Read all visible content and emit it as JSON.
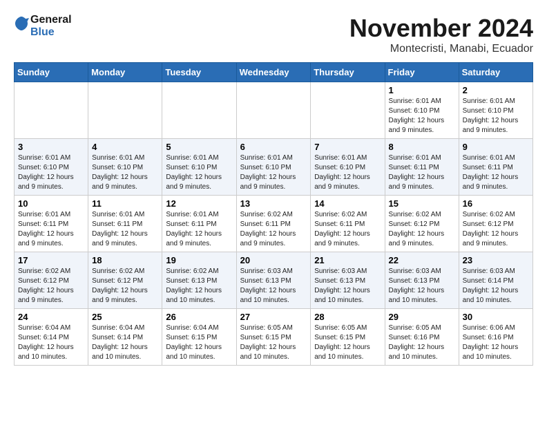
{
  "header": {
    "logo_line1": "General",
    "logo_line2": "Blue",
    "month_title": "November 2024",
    "subtitle": "Montecristi, Manabi, Ecuador"
  },
  "days_of_week": [
    "Sunday",
    "Monday",
    "Tuesday",
    "Wednesday",
    "Thursday",
    "Friday",
    "Saturday"
  ],
  "weeks": [
    [
      {
        "day": "",
        "info": ""
      },
      {
        "day": "",
        "info": ""
      },
      {
        "day": "",
        "info": ""
      },
      {
        "day": "",
        "info": ""
      },
      {
        "day": "",
        "info": ""
      },
      {
        "day": "1",
        "info": "Sunrise: 6:01 AM\nSunset: 6:10 PM\nDaylight: 12 hours and 9 minutes."
      },
      {
        "day": "2",
        "info": "Sunrise: 6:01 AM\nSunset: 6:10 PM\nDaylight: 12 hours and 9 minutes."
      }
    ],
    [
      {
        "day": "3",
        "info": "Sunrise: 6:01 AM\nSunset: 6:10 PM\nDaylight: 12 hours and 9 minutes."
      },
      {
        "day": "4",
        "info": "Sunrise: 6:01 AM\nSunset: 6:10 PM\nDaylight: 12 hours and 9 minutes."
      },
      {
        "day": "5",
        "info": "Sunrise: 6:01 AM\nSunset: 6:10 PM\nDaylight: 12 hours and 9 minutes."
      },
      {
        "day": "6",
        "info": "Sunrise: 6:01 AM\nSunset: 6:10 PM\nDaylight: 12 hours and 9 minutes."
      },
      {
        "day": "7",
        "info": "Sunrise: 6:01 AM\nSunset: 6:10 PM\nDaylight: 12 hours and 9 minutes."
      },
      {
        "day": "8",
        "info": "Sunrise: 6:01 AM\nSunset: 6:11 PM\nDaylight: 12 hours and 9 minutes."
      },
      {
        "day": "9",
        "info": "Sunrise: 6:01 AM\nSunset: 6:11 PM\nDaylight: 12 hours and 9 minutes."
      }
    ],
    [
      {
        "day": "10",
        "info": "Sunrise: 6:01 AM\nSunset: 6:11 PM\nDaylight: 12 hours and 9 minutes."
      },
      {
        "day": "11",
        "info": "Sunrise: 6:01 AM\nSunset: 6:11 PM\nDaylight: 12 hours and 9 minutes."
      },
      {
        "day": "12",
        "info": "Sunrise: 6:01 AM\nSunset: 6:11 PM\nDaylight: 12 hours and 9 minutes."
      },
      {
        "day": "13",
        "info": "Sunrise: 6:02 AM\nSunset: 6:11 PM\nDaylight: 12 hours and 9 minutes."
      },
      {
        "day": "14",
        "info": "Sunrise: 6:02 AM\nSunset: 6:11 PM\nDaylight: 12 hours and 9 minutes."
      },
      {
        "day": "15",
        "info": "Sunrise: 6:02 AM\nSunset: 6:12 PM\nDaylight: 12 hours and 9 minutes."
      },
      {
        "day": "16",
        "info": "Sunrise: 6:02 AM\nSunset: 6:12 PM\nDaylight: 12 hours and 9 minutes."
      }
    ],
    [
      {
        "day": "17",
        "info": "Sunrise: 6:02 AM\nSunset: 6:12 PM\nDaylight: 12 hours and 9 minutes."
      },
      {
        "day": "18",
        "info": "Sunrise: 6:02 AM\nSunset: 6:12 PM\nDaylight: 12 hours and 9 minutes."
      },
      {
        "day": "19",
        "info": "Sunrise: 6:02 AM\nSunset: 6:13 PM\nDaylight: 12 hours and 10 minutes."
      },
      {
        "day": "20",
        "info": "Sunrise: 6:03 AM\nSunset: 6:13 PM\nDaylight: 12 hours and 10 minutes."
      },
      {
        "day": "21",
        "info": "Sunrise: 6:03 AM\nSunset: 6:13 PM\nDaylight: 12 hours and 10 minutes."
      },
      {
        "day": "22",
        "info": "Sunrise: 6:03 AM\nSunset: 6:13 PM\nDaylight: 12 hours and 10 minutes."
      },
      {
        "day": "23",
        "info": "Sunrise: 6:03 AM\nSunset: 6:14 PM\nDaylight: 12 hours and 10 minutes."
      }
    ],
    [
      {
        "day": "24",
        "info": "Sunrise: 6:04 AM\nSunset: 6:14 PM\nDaylight: 12 hours and 10 minutes."
      },
      {
        "day": "25",
        "info": "Sunrise: 6:04 AM\nSunset: 6:14 PM\nDaylight: 12 hours and 10 minutes."
      },
      {
        "day": "26",
        "info": "Sunrise: 6:04 AM\nSunset: 6:15 PM\nDaylight: 12 hours and 10 minutes."
      },
      {
        "day": "27",
        "info": "Sunrise: 6:05 AM\nSunset: 6:15 PM\nDaylight: 12 hours and 10 minutes."
      },
      {
        "day": "28",
        "info": "Sunrise: 6:05 AM\nSunset: 6:15 PM\nDaylight: 12 hours and 10 minutes."
      },
      {
        "day": "29",
        "info": "Sunrise: 6:05 AM\nSunset: 6:16 PM\nDaylight: 12 hours and 10 minutes."
      },
      {
        "day": "30",
        "info": "Sunrise: 6:06 AM\nSunset: 6:16 PM\nDaylight: 12 hours and 10 minutes."
      }
    ]
  ]
}
